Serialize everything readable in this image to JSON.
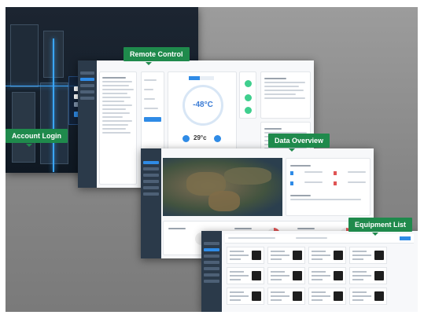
{
  "labels": {
    "remote_control": "Remote Control",
    "data_overview": "Data Overview",
    "account_login": "Account Login",
    "equipment_list": "Equipment List"
  },
  "remote": {
    "temperature": "-48°C",
    "setpoint": "29°c"
  },
  "colors": {
    "tag_green": "#1f8a4c",
    "accent_blue": "#2f8be6",
    "sidebar": "#2b3a4a",
    "background": "#8a8a8a"
  },
  "icons": [
    "power-icon",
    "settings-icon",
    "device-icon"
  ]
}
